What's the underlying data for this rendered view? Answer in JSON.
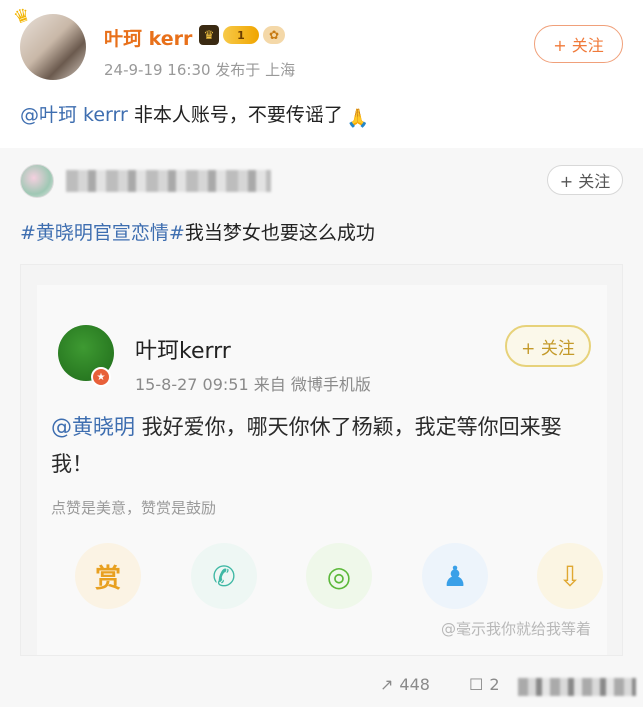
{
  "post": {
    "author": "叶珂 kerr",
    "level_badge": "1",
    "meta": "24-9-19 16:30  发布于 上海",
    "follow_label": "+ 关注",
    "mention": "@叶珂 kerrr",
    "text": " 非本人账号，不要传谣了"
  },
  "repost": {
    "follow_label": "+ 关注",
    "topic": "#黄晓明官宣恋情#",
    "text": "我当梦女也要这么成功"
  },
  "screenshot": {
    "author": "叶珂kerrr",
    "meta": "15-8-27 09:51  来自 微博手机版",
    "follow_label": "+ 关注",
    "mention": "@黄晓明",
    "text": " 我好爱你，哪天你休了杨颖，我定等你回来娶我！",
    "hint": "点赞是美意，赞赏是鼓励",
    "actions": [
      {
        "name": "reward",
        "glyph": "赏"
      },
      {
        "name": "wechat",
        "glyph": "✆"
      },
      {
        "name": "moments",
        "glyph": "◎"
      },
      {
        "name": "qq",
        "glyph": "♟"
      },
      {
        "name": "share",
        "glyph": "⇩"
      }
    ]
  },
  "watermark": "@毫示我你就给我等着",
  "counters": {
    "forward_count": "448",
    "comment_count": "2"
  },
  "colors": {
    "orange_name": "#e8701a",
    "link_blue": "#3e6eb0",
    "meta_gray": "#999999"
  }
}
